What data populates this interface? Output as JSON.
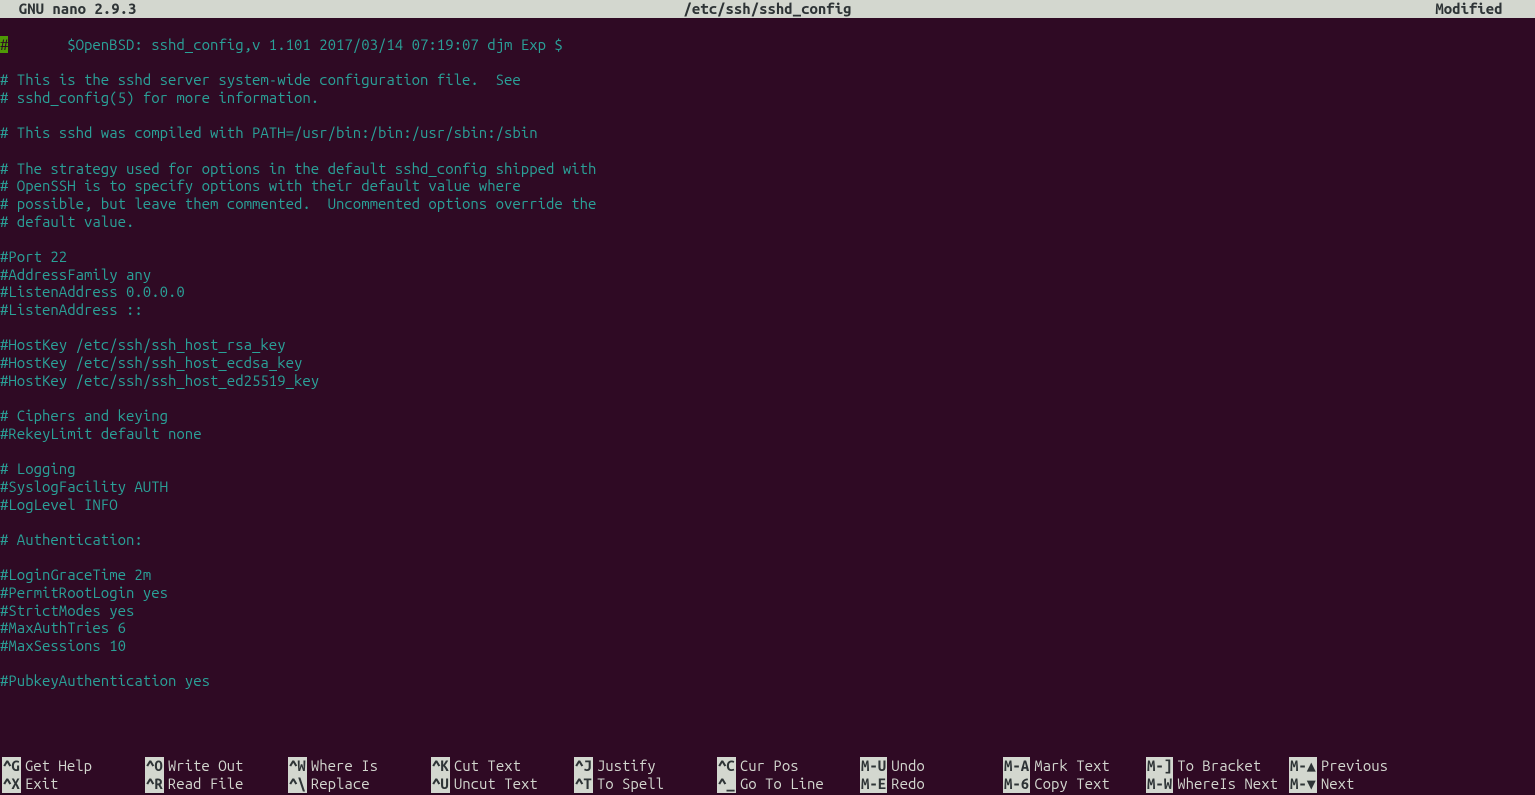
{
  "titlebar": {
    "app": "  GNU nano 2.9.3",
    "filename": "/etc/ssh/sshd_config",
    "status": "Modified "
  },
  "file_lines": [
    "#       $OpenBSD: sshd_config,v 1.101 2017/03/14 07:19:07 djm Exp $",
    "",
    "# This is the sshd server system-wide configuration file.  See",
    "# sshd_config(5) for more information.",
    "",
    "# This sshd was compiled with PATH=/usr/bin:/bin:/usr/sbin:/sbin",
    "",
    "# The strategy used for options in the default sshd_config shipped with",
    "# OpenSSH is to specify options with their default value where",
    "# possible, but leave them commented.  Uncommented options override the",
    "# default value.",
    "",
    "#Port 22",
    "#AddressFamily any",
    "#ListenAddress 0.0.0.0",
    "#ListenAddress ::",
    "",
    "#HostKey /etc/ssh/ssh_host_rsa_key",
    "#HostKey /etc/ssh/ssh_host_ecdsa_key",
    "#HostKey /etc/ssh/ssh_host_ed25519_key",
    "",
    "# Ciphers and keying",
    "#RekeyLimit default none",
    "",
    "# Logging",
    "#SyslogFacility AUTH",
    "#LogLevel INFO",
    "",
    "# Authentication:",
    "",
    "#LoginGraceTime 2m",
    "#PermitRootLogin yes",
    "#StrictModes yes",
    "#MaxAuthTries 6",
    "#MaxSessions 10",
    "",
    "#PubkeyAuthentication yes"
  ],
  "shortcuts": {
    "row1": [
      {
        "key": "^G",
        "label": "Get Help"
      },
      {
        "key": "^O",
        "label": "Write Out"
      },
      {
        "key": "^W",
        "label": "Where Is"
      },
      {
        "key": "^K",
        "label": "Cut Text"
      },
      {
        "key": "^J",
        "label": "Justify"
      },
      {
        "key": "^C",
        "label": "Cur Pos"
      },
      {
        "key": "M-U",
        "label": "Undo"
      },
      {
        "key": "M-A",
        "label": "Mark Text"
      },
      {
        "key": "M-]",
        "label": "To Bracket"
      },
      {
        "key": "M-▲",
        "label": "Previous"
      }
    ],
    "row2": [
      {
        "key": "^X",
        "label": "Exit"
      },
      {
        "key": "^R",
        "label": "Read File"
      },
      {
        "key": "^\\",
        "label": "Replace"
      },
      {
        "key": "^U",
        "label": "Uncut Text"
      },
      {
        "key": "^T",
        "label": "To Spell"
      },
      {
        "key": "^_",
        "label": "Go To Line"
      },
      {
        "key": "M-E",
        "label": "Redo"
      },
      {
        "key": "M-6",
        "label": "Copy Text"
      },
      {
        "key": "M-W",
        "label": "WhereIs Next"
      },
      {
        "key": "M-▼",
        "label": "Next"
      }
    ]
  }
}
